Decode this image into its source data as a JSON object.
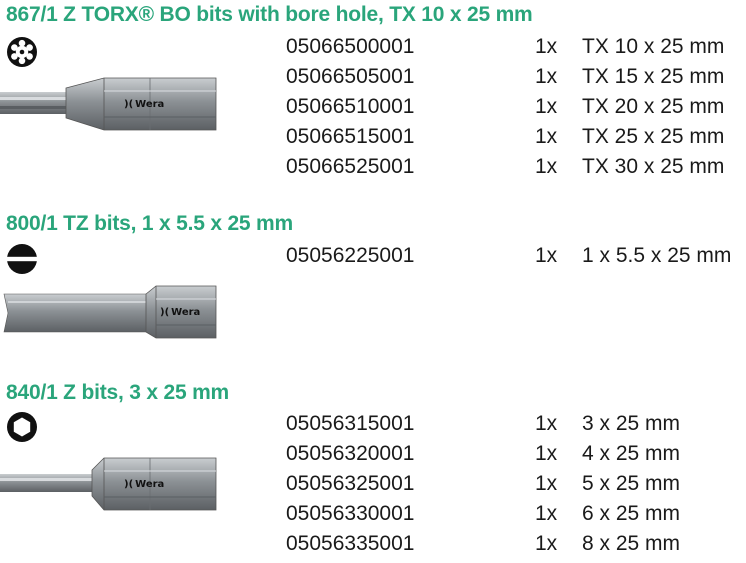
{
  "sections": [
    {
      "title": "867/1 Z TORX® BO bits with bore hole, TX 10 x 25 mm",
      "profile_icon": "torx-profile-icon",
      "bit_icon": "torx-bit-icon",
      "brand": "Wera",
      "items": [
        {
          "article": "05066500001",
          "qty": "1x",
          "desc": "TX 10 x 25 mm"
        },
        {
          "article": "05066505001",
          "qty": "1x",
          "desc": "TX 15 x 25 mm"
        },
        {
          "article": "05066510001",
          "qty": "1x",
          "desc": "TX 20 x 25 mm"
        },
        {
          "article": "05066515001",
          "qty": "1x",
          "desc": "TX 25 x 25 mm"
        },
        {
          "article": "05066525001",
          "qty": "1x",
          "desc": "TX 30 x 25 mm"
        }
      ]
    },
    {
      "title": "800/1 TZ bits, 1 x 5.5 x 25 mm",
      "profile_icon": "slotted-profile-icon",
      "bit_icon": "slotted-bit-icon",
      "brand": "Wera",
      "items": [
        {
          "article": "05056225001",
          "qty": "1x",
          "desc": "1 x 5.5 x 25 mm"
        }
      ]
    },
    {
      "title": "840/1 Z bits, 3 x 25 mm",
      "profile_icon": "hex-profile-icon",
      "bit_icon": "hex-bit-icon",
      "brand": "Wera",
      "items": [
        {
          "article": "05056315001",
          "qty": "1x",
          "desc": "3 x 25 mm"
        },
        {
          "article": "05056320001",
          "qty": "1x",
          "desc": "4 x 25 mm"
        },
        {
          "article": "05056325001",
          "qty": "1x",
          "desc": "5 x 25 mm"
        },
        {
          "article": "05056330001",
          "qty": "1x",
          "desc": "6 x 25 mm"
        },
        {
          "article": "05056335001",
          "qty": "1x",
          "desc": "8 x 25 mm"
        }
      ]
    }
  ],
  "colors": {
    "title": "#2aa57b",
    "text": "#1a1a1a",
    "icon": "#111111",
    "bit_metal": "#8e9397"
  }
}
